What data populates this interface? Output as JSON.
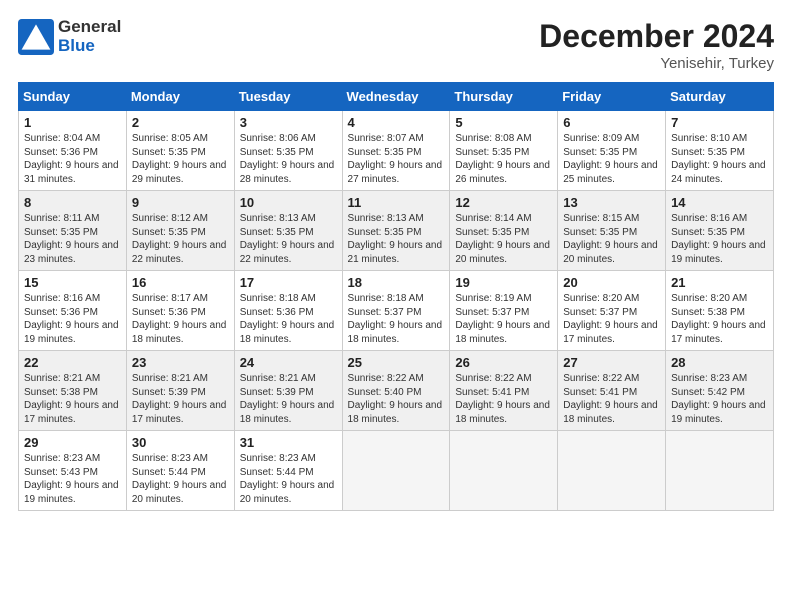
{
  "header": {
    "logo_general": "General",
    "logo_blue": "Blue",
    "month_title": "December 2024",
    "location": "Yenisehir, Turkey"
  },
  "weekdays": [
    "Sunday",
    "Monday",
    "Tuesday",
    "Wednesday",
    "Thursday",
    "Friday",
    "Saturday"
  ],
  "weeks": [
    [
      {
        "day": "1",
        "sunrise": "8:04 AM",
        "sunset": "5:36 PM",
        "daylight": "9 hours and 31 minutes."
      },
      {
        "day": "2",
        "sunrise": "8:05 AM",
        "sunset": "5:35 PM",
        "daylight": "9 hours and 29 minutes."
      },
      {
        "day": "3",
        "sunrise": "8:06 AM",
        "sunset": "5:35 PM",
        "daylight": "9 hours and 28 minutes."
      },
      {
        "day": "4",
        "sunrise": "8:07 AM",
        "sunset": "5:35 PM",
        "daylight": "9 hours and 27 minutes."
      },
      {
        "day": "5",
        "sunrise": "8:08 AM",
        "sunset": "5:35 PM",
        "daylight": "9 hours and 26 minutes."
      },
      {
        "day": "6",
        "sunrise": "8:09 AM",
        "sunset": "5:35 PM",
        "daylight": "9 hours and 25 minutes."
      },
      {
        "day": "7",
        "sunrise": "8:10 AM",
        "sunset": "5:35 PM",
        "daylight": "9 hours and 24 minutes."
      }
    ],
    [
      {
        "day": "8",
        "sunrise": "8:11 AM",
        "sunset": "5:35 PM",
        "daylight": "9 hours and 23 minutes."
      },
      {
        "day": "9",
        "sunrise": "8:12 AM",
        "sunset": "5:35 PM",
        "daylight": "9 hours and 22 minutes."
      },
      {
        "day": "10",
        "sunrise": "8:13 AM",
        "sunset": "5:35 PM",
        "daylight": "9 hours and 22 minutes."
      },
      {
        "day": "11",
        "sunrise": "8:13 AM",
        "sunset": "5:35 PM",
        "daylight": "9 hours and 21 minutes."
      },
      {
        "day": "12",
        "sunrise": "8:14 AM",
        "sunset": "5:35 PM",
        "daylight": "9 hours and 20 minutes."
      },
      {
        "day": "13",
        "sunrise": "8:15 AM",
        "sunset": "5:35 PM",
        "daylight": "9 hours and 20 minutes."
      },
      {
        "day": "14",
        "sunrise": "8:16 AM",
        "sunset": "5:35 PM",
        "daylight": "9 hours and 19 minutes."
      }
    ],
    [
      {
        "day": "15",
        "sunrise": "8:16 AM",
        "sunset": "5:36 PM",
        "daylight": "9 hours and 19 minutes."
      },
      {
        "day": "16",
        "sunrise": "8:17 AM",
        "sunset": "5:36 PM",
        "daylight": "9 hours and 18 minutes."
      },
      {
        "day": "17",
        "sunrise": "8:18 AM",
        "sunset": "5:36 PM",
        "daylight": "9 hours and 18 minutes."
      },
      {
        "day": "18",
        "sunrise": "8:18 AM",
        "sunset": "5:37 PM",
        "daylight": "9 hours and 18 minutes."
      },
      {
        "day": "19",
        "sunrise": "8:19 AM",
        "sunset": "5:37 PM",
        "daylight": "9 hours and 18 minutes."
      },
      {
        "day": "20",
        "sunrise": "8:20 AM",
        "sunset": "5:37 PM",
        "daylight": "9 hours and 17 minutes."
      },
      {
        "day": "21",
        "sunrise": "8:20 AM",
        "sunset": "5:38 PM",
        "daylight": "9 hours and 17 minutes."
      }
    ],
    [
      {
        "day": "22",
        "sunrise": "8:21 AM",
        "sunset": "5:38 PM",
        "daylight": "9 hours and 17 minutes."
      },
      {
        "day": "23",
        "sunrise": "8:21 AM",
        "sunset": "5:39 PM",
        "daylight": "9 hours and 17 minutes."
      },
      {
        "day": "24",
        "sunrise": "8:21 AM",
        "sunset": "5:39 PM",
        "daylight": "9 hours and 18 minutes."
      },
      {
        "day": "25",
        "sunrise": "8:22 AM",
        "sunset": "5:40 PM",
        "daylight": "9 hours and 18 minutes."
      },
      {
        "day": "26",
        "sunrise": "8:22 AM",
        "sunset": "5:41 PM",
        "daylight": "9 hours and 18 minutes."
      },
      {
        "day": "27",
        "sunrise": "8:22 AM",
        "sunset": "5:41 PM",
        "daylight": "9 hours and 18 minutes."
      },
      {
        "day": "28",
        "sunrise": "8:23 AM",
        "sunset": "5:42 PM",
        "daylight": "9 hours and 19 minutes."
      }
    ],
    [
      {
        "day": "29",
        "sunrise": "8:23 AM",
        "sunset": "5:43 PM",
        "daylight": "9 hours and 19 minutes."
      },
      {
        "day": "30",
        "sunrise": "8:23 AM",
        "sunset": "5:44 PM",
        "daylight": "9 hours and 20 minutes."
      },
      {
        "day": "31",
        "sunrise": "8:23 AM",
        "sunset": "5:44 PM",
        "daylight": "9 hours and 20 minutes."
      },
      null,
      null,
      null,
      null
    ]
  ]
}
